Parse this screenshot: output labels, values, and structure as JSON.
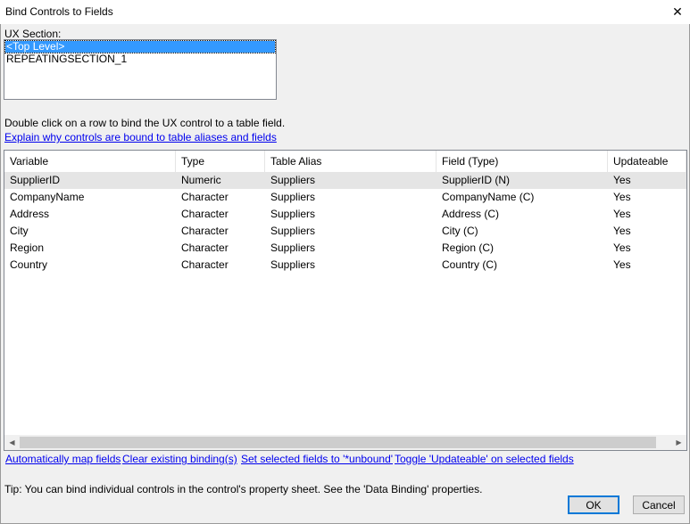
{
  "window": {
    "title": "Bind Controls to Fields",
    "close_glyph": "✕"
  },
  "ux_section": {
    "label": "UX Section:",
    "items": [
      "<Top Level>",
      "REPEATINGSECTION_1"
    ],
    "selected_index": 0
  },
  "instruction": "Double click on a row to bind the UX control to a table field.",
  "explain_link": "Explain why controls are bound to table aliases and fields",
  "table": {
    "columns": [
      "Variable",
      "Type",
      "Table Alias",
      "Field (Type)",
      "Updateable"
    ],
    "rows": [
      [
        "SupplierID",
        "Numeric",
        "Suppliers",
        "SupplierID (N)",
        "Yes"
      ],
      [
        "CompanyName",
        "Character",
        "Suppliers",
        "CompanyName (C)",
        "Yes"
      ],
      [
        "Address",
        "Character",
        "Suppliers",
        "Address (C)",
        "Yes"
      ],
      [
        "City",
        "Character",
        "Suppliers",
        "City (C)",
        "Yes"
      ],
      [
        "Region",
        "Character",
        "Suppliers",
        "Region (C)",
        "Yes"
      ],
      [
        "Country",
        "Character",
        "Suppliers",
        "Country (C)",
        "Yes"
      ]
    ],
    "highlighted_row": 0
  },
  "scrollbar": {
    "left_arrow": "◀",
    "right_arrow": "▶"
  },
  "actions": {
    "auto_map": "Automatically map fields",
    "clear_bindings": "Clear existing binding(s)",
    "set_unbound": "Set selected fields to '*unbound'",
    "toggle_updateable": "Toggle 'Updateable' on selected fields"
  },
  "tip": "Tip: You can bind individual controls in the control's property sheet. See the 'Data Binding' properties.",
  "buttons": {
    "ok": "OK",
    "cancel": "Cancel"
  },
  "colors": {
    "selection": "#3399ff",
    "link": "#0000ee",
    "row_highlight": "#e5e5e5"
  }
}
